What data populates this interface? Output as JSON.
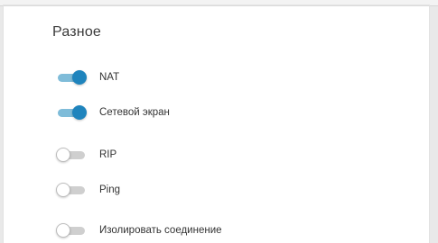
{
  "section": {
    "title": "Разное"
  },
  "toggles": [
    {
      "label": "NAT",
      "on": true
    },
    {
      "label": "Сетевой экран",
      "on": true
    },
    {
      "label": "RIP",
      "on": false
    },
    {
      "label": "Ping",
      "on": false
    },
    {
      "label": "Изолировать соединение",
      "on": false
    }
  ],
  "colors": {
    "accent": "#1f84bd",
    "accent_track": "#7fbcd9",
    "off_track": "#cfcfcf"
  }
}
